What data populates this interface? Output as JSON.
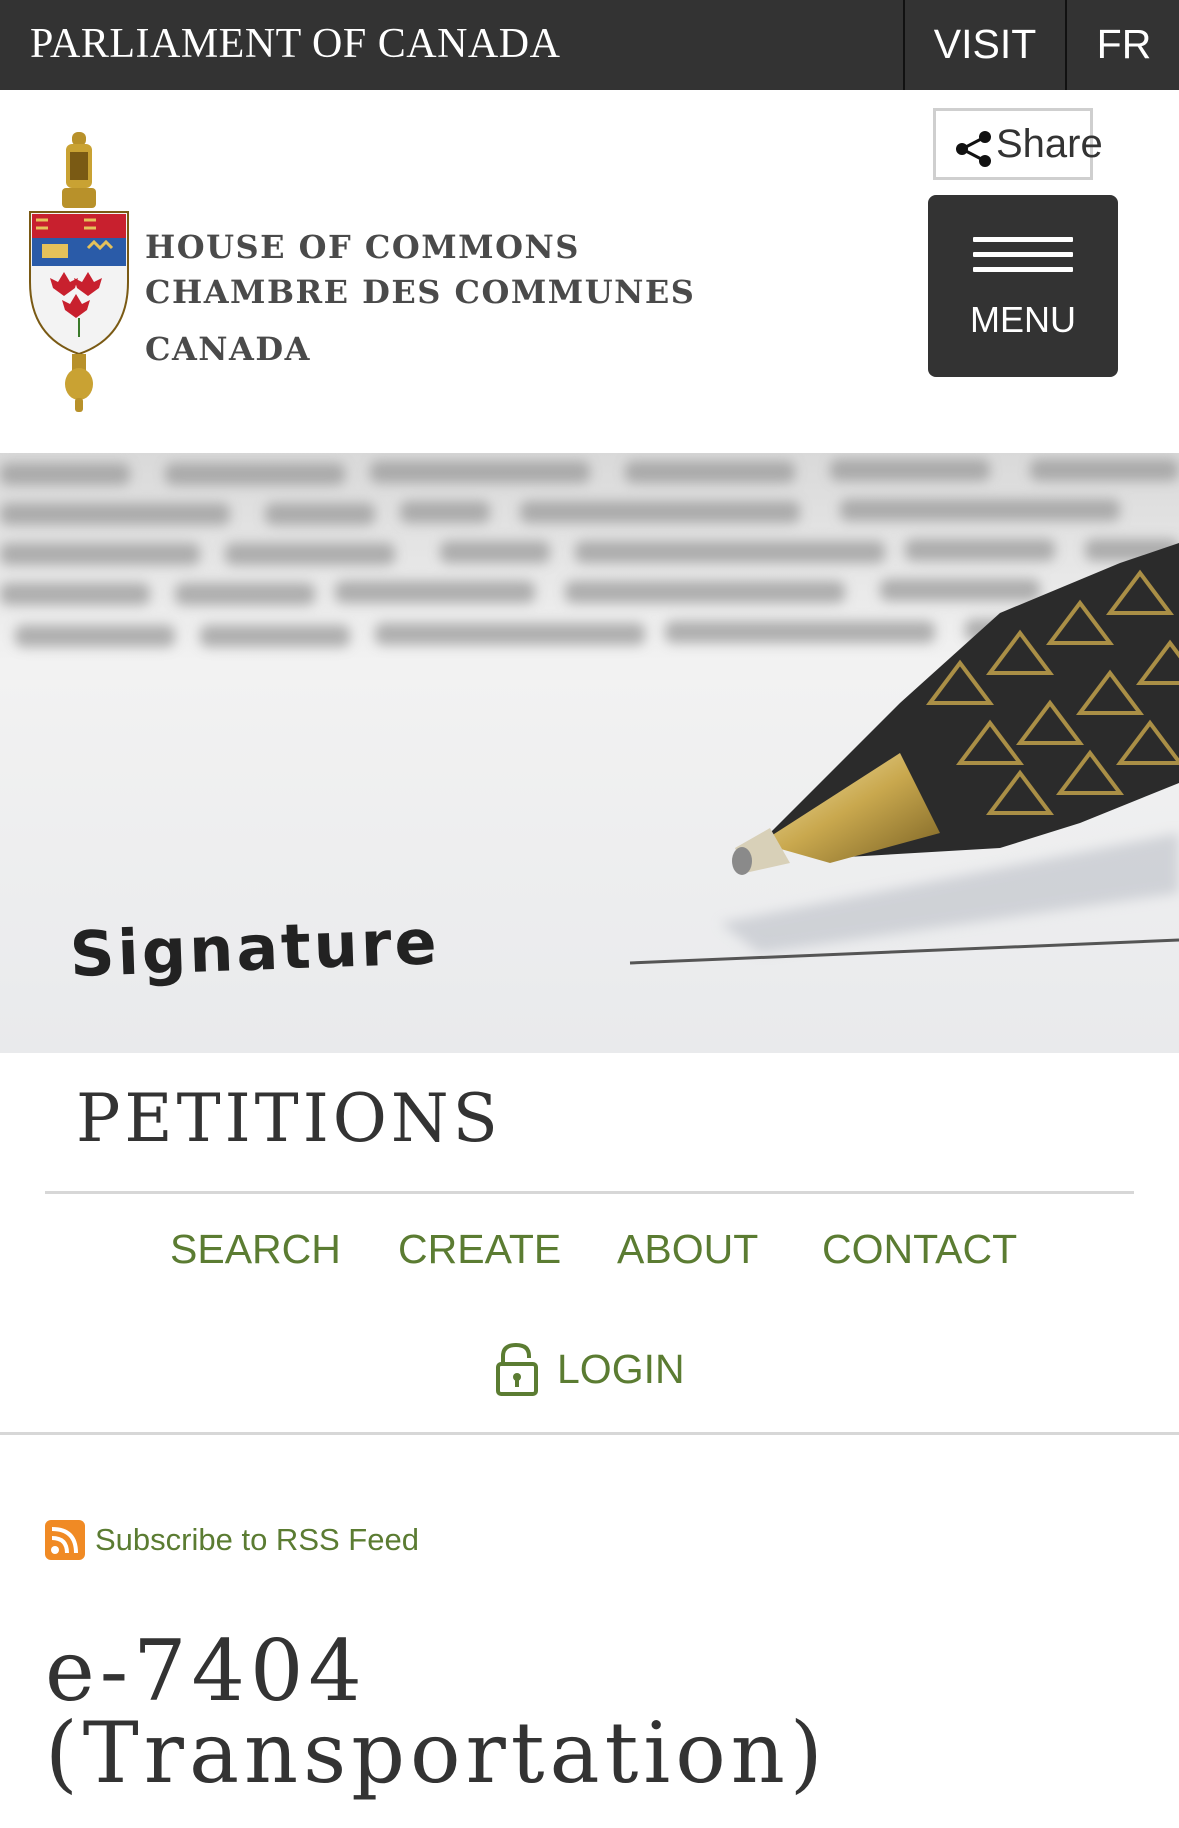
{
  "topbar": {
    "brand": "PARLIAMENT OF CANADA",
    "visit": "VISIT",
    "lang": "FR"
  },
  "header": {
    "logo_line1": "HOUSE OF COMMONS",
    "logo_line2": "CHAMBRE DES COMMUNES",
    "logo_line3": "CANADA",
    "share_label": "Share",
    "menu_label": "MENU"
  },
  "hero": {
    "caption": "Signature"
  },
  "petitions": {
    "title": "PETITIONS",
    "nav": [
      "SEARCH",
      "CREATE",
      "ABOUT",
      "CONTACT"
    ],
    "login": "LOGIN"
  },
  "rss": {
    "label": "Subscribe to RSS Feed"
  },
  "petition": {
    "number": "e-7404",
    "category": "(Transportation)"
  },
  "colors": {
    "topbar": "#333333",
    "link": "#5b7c32",
    "rss": "#f08a24"
  }
}
